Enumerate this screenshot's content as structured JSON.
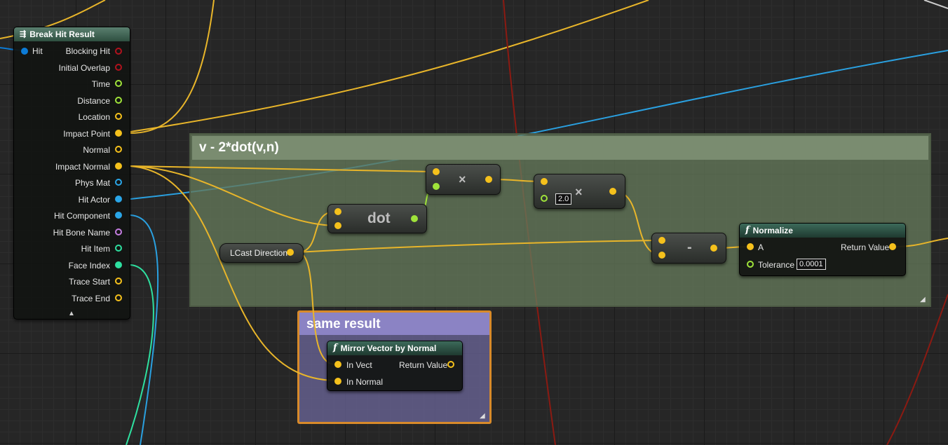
{
  "colors": {
    "vector_pin": "#f5c11c",
    "float_pin": "#9fe33a",
    "bool_pin": "#b0121d",
    "struct_pin": "#0c7bd6",
    "object_pin": "#2aa6e8",
    "name_pin": "#c47de0",
    "int_pin": "#2ee0a0",
    "exec_wire_red": "#8b1a12"
  },
  "break_hit_result": {
    "title": "Break Hit Result",
    "icon": "break-struct-icon",
    "input_pin": "Hit",
    "outputs": [
      "Blocking Hit",
      "Initial Overlap",
      "Time",
      "Distance",
      "Location",
      "Impact Point",
      "Normal",
      "Impact Normal",
      "Phys Mat",
      "Hit Actor",
      "Hit Component",
      "Hit Bone Name",
      "Hit Item",
      "Face Index",
      "Trace Start",
      "Trace End"
    ],
    "collapse_icon": "triangle-up-icon"
  },
  "comment_formula": {
    "title": "v - 2*dot(v,n)"
  },
  "comment_same": {
    "title": "same result"
  },
  "dot_node": {
    "label": "dot"
  },
  "multiply_node_1": {
    "label": "×"
  },
  "multiply_node_2": {
    "label": "×",
    "value": "2.0"
  },
  "subtract_node": {
    "label": "-"
  },
  "lcast_node": {
    "label": "LCast Direction"
  },
  "normalize_node": {
    "title": "Normalize",
    "icon": "function-icon",
    "input_a": "A",
    "input_tolerance": "Tolerance",
    "tolerance_value": "0.0001",
    "output": "Return Value"
  },
  "mirror_node": {
    "title": "Mirror Vector by Normal",
    "icon": "function-icon",
    "input_vect": "In Vect",
    "input_normal": "In Normal",
    "output": "Return Value"
  }
}
